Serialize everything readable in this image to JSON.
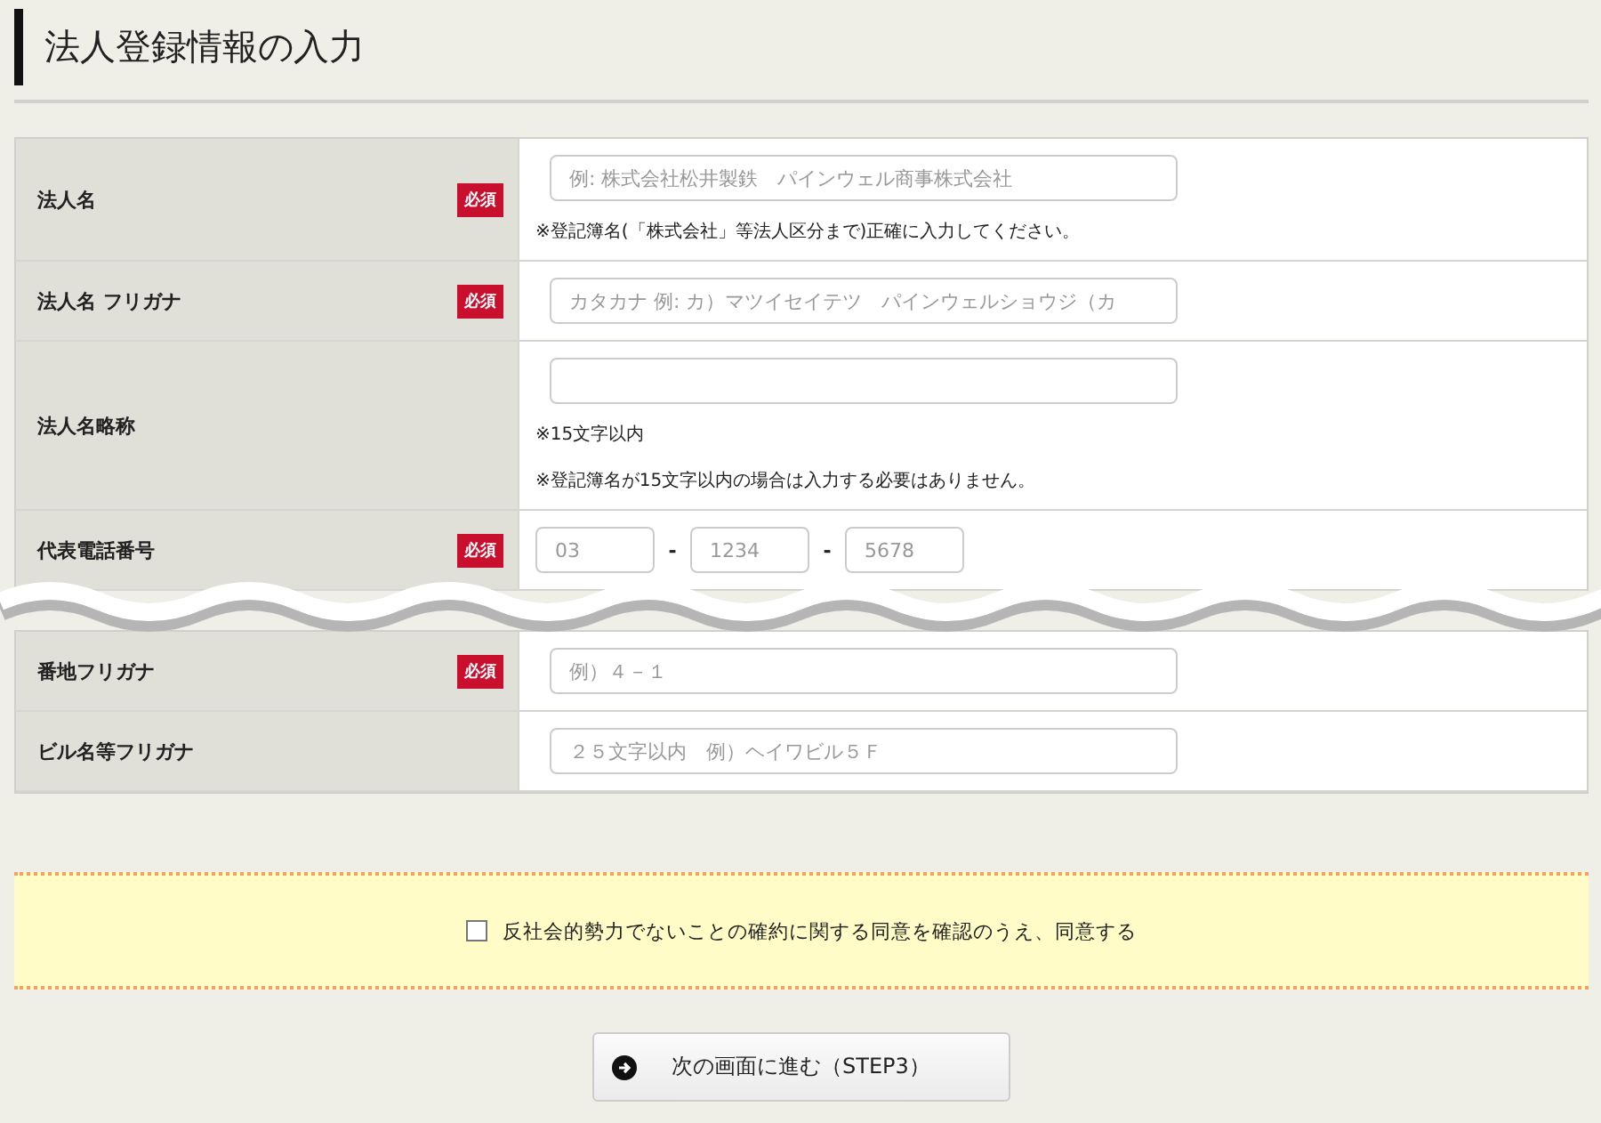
{
  "title": "法人登録情報の入力",
  "sections": [
    {
      "rows": [
        {
          "label": "法人名",
          "required": true,
          "badge": "必須",
          "inputs": [
            {
              "kind": "long",
              "placeholder": "例: 株式会社松井製鉄　パインウェル商事株式会社"
            }
          ],
          "notes": [
            "※登記簿名(「株式会社」等法人区分まで)正確に入力してください。"
          ]
        },
        {
          "label": "法人名 フリガナ",
          "required": true,
          "badge": "必須",
          "inputs": [
            {
              "kind": "long",
              "placeholder": "カタカナ 例: カ）マツイセイテツ　パインウェルショウジ（カ"
            }
          ]
        },
        {
          "label": "法人名略称",
          "required": false,
          "inputs": [
            {
              "kind": "long"
            }
          ],
          "notes": [
            "※15文字以内",
            "※登記簿名が15文字以内の場合は入力する必要はありません。"
          ]
        },
        {
          "label": "代表電話番号",
          "required": true,
          "badge": "必須",
          "inputs": [
            {
              "kind": "short",
              "placeholder": "03"
            },
            {
              "kind": "short",
              "separator": "-",
              "placeholder": "1234"
            },
            {
              "kind": "short",
              "separator": "-",
              "placeholder": "5678"
            }
          ]
        }
      ]
    },
    {
      "rows": [
        {
          "label": "番地フリガナ",
          "required": true,
          "badge": "必須",
          "inputs": [
            {
              "kind": "long",
              "placeholder": "例）４－１"
            }
          ]
        },
        {
          "label": "ビル名等フリガナ",
          "required": false,
          "inputs": [
            {
              "kind": "long",
              "placeholder": "２５文字以内　例）ヘイワビル５Ｆ"
            }
          ]
        }
      ]
    }
  ],
  "agreement": {
    "checked": false,
    "label": "反社会的勢力でないことの確約に関する同意を確認のうえ、同意する"
  },
  "next_button": "次の画面に進む（STEP3）"
}
